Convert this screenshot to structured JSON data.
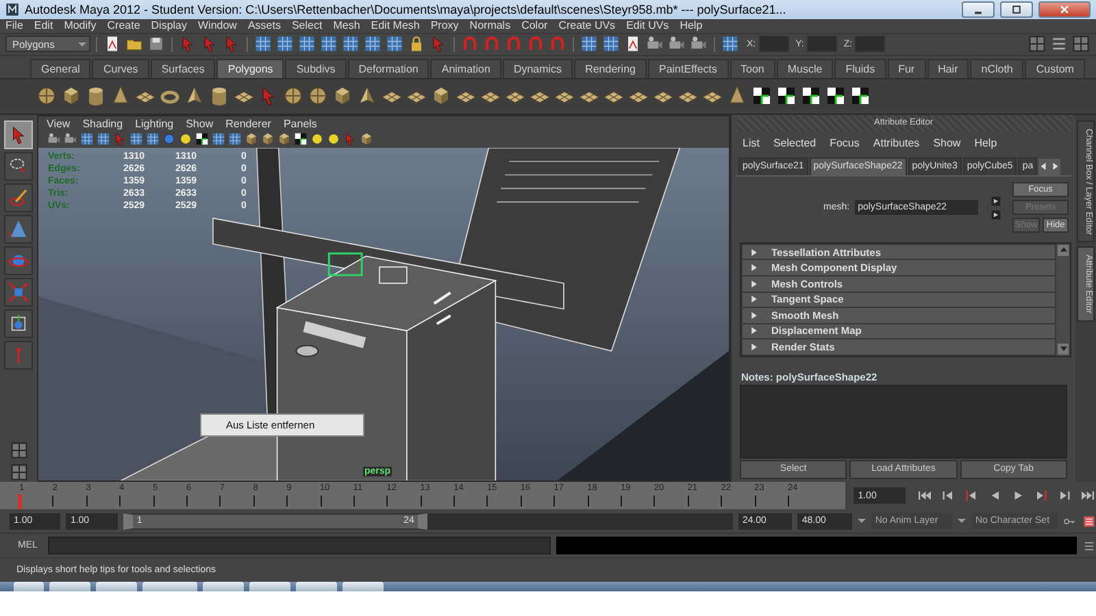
{
  "window": {
    "title": "Autodesk Maya 2012 - Student Version: C:\\Users\\Rettenbacher\\Documents\\maya\\projects\\default\\scenes\\Steyr958.mb*  ---  polySurface21..."
  },
  "menu_bar": [
    "File",
    "Edit",
    "Modify",
    "Create",
    "Display",
    "Window",
    "Assets",
    "Select",
    "Mesh",
    "Edit Mesh",
    "Proxy",
    "Normals",
    "Color",
    "Create UVs",
    "Edit UVs",
    "Help"
  ],
  "status_line": {
    "menu_set": "Polygons",
    "coords": [
      "X:",
      "Y:",
      "Z:"
    ]
  },
  "shelf_tabs": [
    {
      "label": "General",
      "selected": false
    },
    {
      "label": "Curves",
      "selected": false
    },
    {
      "label": "Surfaces",
      "selected": false
    },
    {
      "label": "Polygons",
      "selected": true
    },
    {
      "label": "Subdivs",
      "selected": false
    },
    {
      "label": "Deformation",
      "selected": false
    },
    {
      "label": "Animation",
      "selected": false
    },
    {
      "label": "Dynamics",
      "selected": false
    },
    {
      "label": "Rendering",
      "selected": false
    },
    {
      "label": "PaintEffects",
      "selected": false
    },
    {
      "label": "Toon",
      "selected": false
    },
    {
      "label": "Muscle",
      "selected": false
    },
    {
      "label": "Fluids",
      "selected": false
    },
    {
      "label": "Fur",
      "selected": false
    },
    {
      "label": "Hair",
      "selected": false
    },
    {
      "label": "nCloth",
      "selected": false
    },
    {
      "label": "Custom",
      "selected": false
    }
  ],
  "toolbox": [
    {
      "kind": "select",
      "selected": true
    },
    {
      "kind": "lasso",
      "selected": false
    },
    {
      "kind": "paint",
      "selected": false
    },
    {
      "kind": "move",
      "selected": false
    },
    {
      "kind": "rotate",
      "selected": false
    },
    {
      "kind": "scale",
      "selected": false
    },
    {
      "kind": "manipulator",
      "selected": false
    },
    {
      "kind": "last",
      "selected": false
    }
  ],
  "viewport": {
    "menus": [
      "View",
      "Shading",
      "Lighting",
      "Show",
      "Renderer",
      "Panels"
    ],
    "hud": [
      {
        "label": "Verts:",
        "values": [
          "1310",
          "1310",
          "0"
        ]
      },
      {
        "label": "Edges:",
        "values": [
          "2626",
          "2626",
          "0"
        ]
      },
      {
        "label": "Faces:",
        "values": [
          "1359",
          "1359",
          "0"
        ]
      },
      {
        "label": "Tris:",
        "values": [
          "2633",
          "2633",
          "0"
        ]
      },
      {
        "label": "UVs:",
        "values": [
          "2529",
          "2529",
          "0"
        ]
      }
    ],
    "context_menu": [
      "Aus Liste entfernen"
    ],
    "camera": "persp"
  },
  "attribute_editor": {
    "title": "Attribute Editor",
    "menus": [
      "List",
      "Selected",
      "Focus",
      "Attributes",
      "Show",
      "Help"
    ],
    "tabs": [
      {
        "label": "polySurface21",
        "selected": false
      },
      {
        "label": "polySurfaceShape22",
        "selected": true
      },
      {
        "label": "polyUnite3",
        "selected": false
      },
      {
        "label": "polyCube5",
        "selected": false
      },
      {
        "label": "pa",
        "selected": false
      }
    ],
    "mesh_label": "mesh:",
    "mesh_value": "polySurfaceShape22",
    "buttons": [
      {
        "label": "Focus",
        "disabled": false
      },
      {
        "label": "Presets",
        "disabled": true
      },
      {
        "label": "Show",
        "disabled": true
      },
      {
        "label": "Hide",
        "disabled": false
      }
    ],
    "sections": [
      {
        "label": "Tessellation Attributes",
        "expanded": false
      },
      {
        "label": "Mesh Component Display",
        "expanded": false
      },
      {
        "label": "Mesh Controls",
        "expanded": false
      },
      {
        "label": "Tangent Space",
        "expanded": false
      },
      {
        "label": "Smooth Mesh",
        "expanded": false
      },
      {
        "label": "Displacement Map",
        "expanded": false
      },
      {
        "label": "Render Stats",
        "expanded": false
      }
    ],
    "notes_label": "Notes:  polySurfaceShape22",
    "actions": [
      "Select",
      "Load Attributes",
      "Copy Tab"
    ]
  },
  "side_tabs": [
    {
      "label": "Channel Box / Layer Editor",
      "selected": false
    },
    {
      "label": "Attribute Editor",
      "selected": true
    }
  ],
  "time_slider": {
    "ticks": [
      "1",
      "2",
      "3",
      "4",
      "5",
      "6",
      "7",
      "8",
      "9",
      "10",
      "11",
      "12",
      "13",
      "14",
      "15",
      "16",
      "17",
      "18",
      "19",
      "20",
      "21",
      "22",
      "23",
      "24"
    ],
    "current_frame": "1.00",
    "level": 0
  },
  "range_slider": {
    "start": "1.00",
    "playback_start": "1.00",
    "level": 0.5,
    "range_start": "1",
    "range_end": "24",
    "playback_end": "24.00",
    "end": "48.00",
    "anim_layer": "No Anim Layer",
    "character_set": "No Character Set"
  },
  "command_line": {
    "language": "MEL"
  },
  "help_line": "Displays short help tips for tools and selections"
}
